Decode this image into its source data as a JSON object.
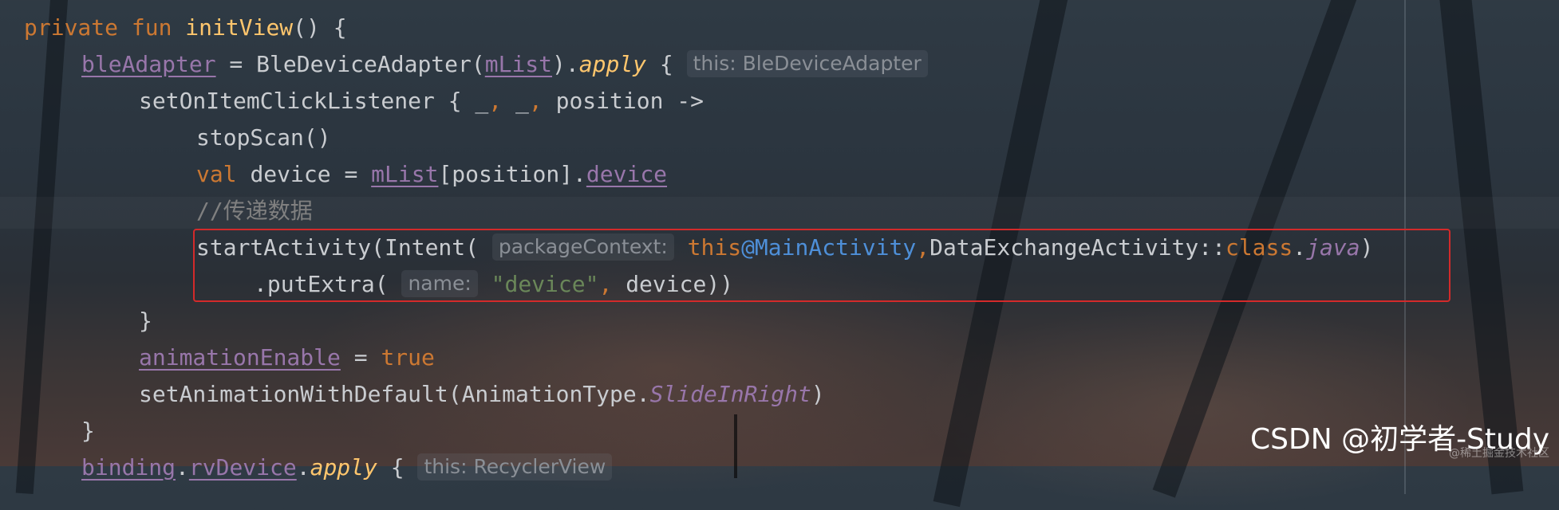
{
  "editor": {
    "lines": [
      {
        "tokens": [
          {
            "t": "private ",
            "c": "kw"
          },
          {
            "t": "fun ",
            "c": "kw"
          },
          {
            "t": "initView",
            "c": "fn"
          },
          {
            "t": "() {",
            "c": ""
          }
        ]
      },
      {
        "tokens": [
          {
            "t": "bleAdapter",
            "c": "prop-u"
          },
          {
            "t": " = BleDeviceAdapter(",
            "c": ""
          },
          {
            "t": "mList",
            "c": "prop-u"
          },
          {
            "t": ").",
            "c": ""
          },
          {
            "t": "apply",
            "c": "ext"
          },
          {
            "t": " { ",
            "c": ""
          },
          {
            "t": "this: BleDeviceAdapter",
            "c": "hint"
          }
        ]
      },
      {
        "tokens": [
          {
            "t": "setOnItemClickListener { _",
            "c": ""
          },
          {
            "t": ",",
            "c": "kw"
          },
          {
            "t": " _",
            "c": ""
          },
          {
            "t": ",",
            "c": "kw"
          },
          {
            "t": " position ->",
            "c": ""
          }
        ]
      },
      {
        "tokens": [
          {
            "t": "stopScan()",
            "c": ""
          }
        ]
      },
      {
        "tokens": [
          {
            "t": "val ",
            "c": "kw"
          },
          {
            "t": "device = ",
            "c": ""
          },
          {
            "t": "mList",
            "c": "prop-u"
          },
          {
            "t": "[position].",
            "c": ""
          },
          {
            "t": "device",
            "c": "prop-u"
          }
        ]
      },
      {
        "tokens": [
          {
            "t": "//传递数据",
            "c": "comment"
          }
        ]
      },
      {
        "tokens": [
          {
            "t": "startActivity(Intent( ",
            "c": ""
          },
          {
            "t": "packageContext:",
            "c": "hint"
          },
          {
            "t": " this",
            "c": "kw"
          },
          {
            "t": "@MainActivity",
            "c": "anno"
          },
          {
            "t": ",",
            "c": "kw"
          },
          {
            "t": "DataExchangeActivity::",
            "c": ""
          },
          {
            "t": "class",
            "c": "kw"
          },
          {
            "t": ".",
            "c": ""
          },
          {
            "t": "java",
            "c": "italic-enum"
          },
          {
            "t": ")",
            "c": ""
          }
        ]
      },
      {
        "tokens": [
          {
            "t": ".putExtra( ",
            "c": ""
          },
          {
            "t": "name:",
            "c": "hint"
          },
          {
            "t": " \"device\"",
            "c": "str"
          },
          {
            "t": ",",
            "c": "kw"
          },
          {
            "t": " device))",
            "c": ""
          }
        ]
      },
      {
        "tokens": [
          {
            "t": "}",
            "c": ""
          }
        ]
      },
      {
        "tokens": [
          {
            "t": "animationEnable",
            "c": "prop-u"
          },
          {
            "t": " = ",
            "c": ""
          },
          {
            "t": "true",
            "c": "kw"
          }
        ]
      },
      {
        "tokens": [
          {
            "t": "setAnimationWithDefault(AnimationType.",
            "c": ""
          },
          {
            "t": "SlideInRight",
            "c": "italic-enum"
          },
          {
            "t": ")",
            "c": ""
          }
        ]
      },
      {
        "tokens": [
          {
            "t": "}",
            "c": ""
          }
        ]
      },
      {
        "tokens": [
          {
            "t": "binding",
            "c": "prop-u"
          },
          {
            "t": ".",
            "c": ""
          },
          {
            "t": "rvDevice",
            "c": "prop-u"
          },
          {
            "t": ".",
            "c": ""
          },
          {
            "t": "apply",
            "c": "ext"
          },
          {
            "t": " { ",
            "c": ""
          },
          {
            "t": "this: RecyclerView",
            "c": "hint"
          }
        ]
      }
    ]
  },
  "watermark": {
    "main": "CSDN @初学者-Study",
    "sub": "@稀土掘金技术社区"
  },
  "colors": {
    "keyword": "#cc7832",
    "function": "#ffc66d",
    "property": "#9876aa",
    "string": "#6a8759",
    "comment": "#808080",
    "annotation": "#4e8fd8",
    "text": "#c9ccd0",
    "highlight_border": "#d32a2a"
  }
}
